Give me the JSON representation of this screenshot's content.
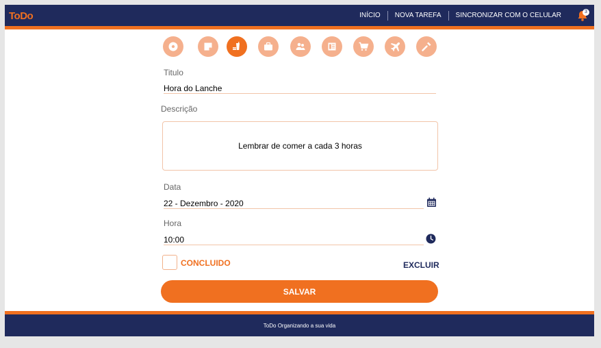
{
  "header": {
    "logo": "ToDo",
    "nav": [
      "INÍCIO",
      "NOVA TAREFA",
      "SINCRONIZAR COM O CELULAR"
    ],
    "notification_count": "3"
  },
  "categories": [
    {
      "icon": "soccer-ball-icon",
      "active": false
    },
    {
      "icon": "sticky-note-icon",
      "active": false
    },
    {
      "icon": "food-drink-icon",
      "active": true
    },
    {
      "icon": "briefcase-icon",
      "active": false
    },
    {
      "icon": "people-icon",
      "active": false
    },
    {
      "icon": "newspaper-icon",
      "active": false
    },
    {
      "icon": "shopping-cart-icon",
      "active": false
    },
    {
      "icon": "airplane-icon",
      "active": false
    },
    {
      "icon": "tools-icon",
      "active": false
    }
  ],
  "form": {
    "title_label": "Titulo",
    "title_value": "Hora do Lanche",
    "description_label": "Descrição",
    "description_value": "Lembrar de comer a cada 3 horas",
    "date_label": "Data",
    "date_value": "22 - Dezembro - 2020",
    "time_label": "Hora",
    "time_value": "10:00",
    "done_label": "CONCLUIDO",
    "done_checked": false,
    "delete_label": "EXCLUIR",
    "save_label": "SALVAR"
  },
  "footer": {
    "text": "ToDo Organizando a sua vida"
  },
  "colors": {
    "navy": "#1f2a5c",
    "orange": "#f07020",
    "orange_light": "#f5b08d"
  }
}
